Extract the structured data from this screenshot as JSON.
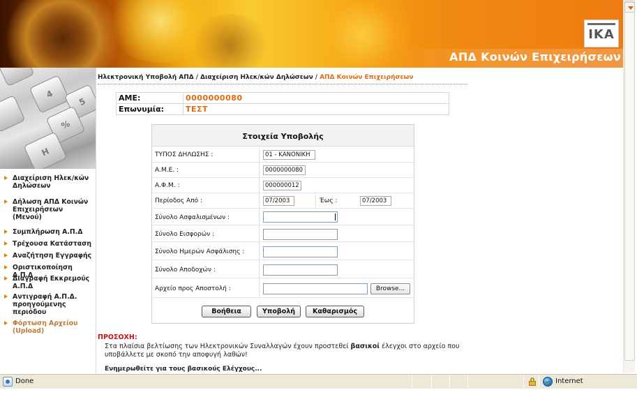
{
  "banner": {
    "title": "ΑΠΔ Κοινών Επιχειρήσεων",
    "logo_text": "ΙΚΑ"
  },
  "sidebar": {
    "keys": [
      "4",
      "5",
      "%",
      "H"
    ],
    "items": [
      {
        "label": "Διαχείριση Ηλεκ/κών Δηλώσεων",
        "enabled": true
      },
      {
        "label": "Δήλωση ΑΠΔ Κοινών Επιχειρήσεων (Μενού)",
        "enabled": true
      },
      {
        "label": "Συμπλήρωση Α.Π.Δ",
        "enabled": true
      },
      {
        "label": "Τρέχουσα Κατάσταση",
        "enabled": true
      },
      {
        "label": "Αναζήτηση Εγγραφής",
        "enabled": true
      },
      {
        "label": "Οριστικοποίηση Α.Π.Δ",
        "enabled": true
      },
      {
        "label": "Διαγραφή Εκκρεμούς Α.Π.Δ",
        "enabled": true
      },
      {
        "label": "Αντιγραφή Α.Π.Δ. προηγούμενης περιόδου",
        "enabled": true
      },
      {
        "label": "Φόρτωση Αρχείου (Upload)",
        "enabled": false
      }
    ]
  },
  "breadcrumb": {
    "items": [
      "Ηλεκτρονική Υποβολή ΑΠΔ",
      "Διαχείριση Ηλεκ/κών Δηλώσεων",
      "ΑΠΔ Κοινών Επιχειρήσεων"
    ],
    "separator": "/"
  },
  "employer": {
    "ame_label": "ΑΜΕ:",
    "ame_value": "0000000080",
    "name_label": "Επωνυμία:",
    "name_value": "ΤΕΣΤ"
  },
  "form": {
    "title": "Στοιχεία Υποβολής",
    "type_label": "ΤΥΠΟΣ ΔΗΛΩΣΗΣ :",
    "type_value": "01 - ΚΑΝΟΝΙΚΗ",
    "ame_label": "Α.Μ.Ε. :",
    "ame_value": "0000000080",
    "afm_label": "Α.Φ.Μ. :",
    "afm_value": "000000012",
    "period_from_label": "Περίοδος Από :",
    "period_from_value": "07/2003",
    "period_to_label": "Έως :",
    "period_to_value": "07/2003",
    "insured_label": "Σύνολο Ασφαλισμένων :",
    "insured_value": "",
    "contrib_label": "Σύνολο Εισφορών :",
    "contrib_value": "",
    "days_label": "Σύνολο Ημερών Ασφάλισης :",
    "days_value": "",
    "earnings_label": "Σύνολο Αποδοχών :",
    "earnings_value": "",
    "file_label": "Αρχείο προς Αποστολή :",
    "file_value": "",
    "browse_label": "Browse...",
    "help_label": "Βοήθεια",
    "submit_label": "Υποβολή",
    "clear_label": "Καθαρισμός"
  },
  "notice": {
    "title": "ΠΡΟΣΟΧΗ:",
    "text_before": "Στα πλαίσια βελτίωσης των Ηλεκτρονικών Συναλλαγών έχουν προστεθεί ",
    "text_bold": "βασικοί",
    "text_after": " έλεγχοι στο αρχείο που υποβάλλετε με σκοπό την αποφυγή λαθών!",
    "more_link": "Ενημερωθείτε για τους βασικούς Ελέγχους..."
  },
  "status": {
    "text": "Done",
    "zone": "Internet"
  },
  "colors": {
    "accent": "#e06b10",
    "banner_orange": "#ef7b10",
    "warning_red": "#c41111"
  }
}
